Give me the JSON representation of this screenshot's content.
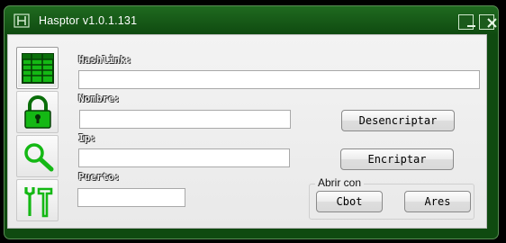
{
  "window": {
    "title": "Hasptor v1.0.1.131",
    "accent": "#0f4a10"
  },
  "sidebar": {
    "items": [
      {
        "name": "table",
        "icon": "table-icon"
      },
      {
        "name": "lock",
        "icon": "lock-icon"
      },
      {
        "name": "search",
        "icon": "search-icon"
      },
      {
        "name": "tools",
        "icon": "tools-icon"
      }
    ]
  },
  "form": {
    "hashlink_label": "Hashlink:",
    "hashlink_value": "",
    "nombre_label": "Nombre:",
    "nombre_value": "",
    "ip_label": "Ip:",
    "ip_value": "",
    "puerto_label": "Puerto:",
    "puerto_value": ""
  },
  "actions": {
    "desencriptar_label": "Desencriptar",
    "encriptar_label": "Encriptar"
  },
  "open_with": {
    "label": "Abrir con",
    "cbot_label": "Cbot",
    "ares_label": "Ares"
  }
}
